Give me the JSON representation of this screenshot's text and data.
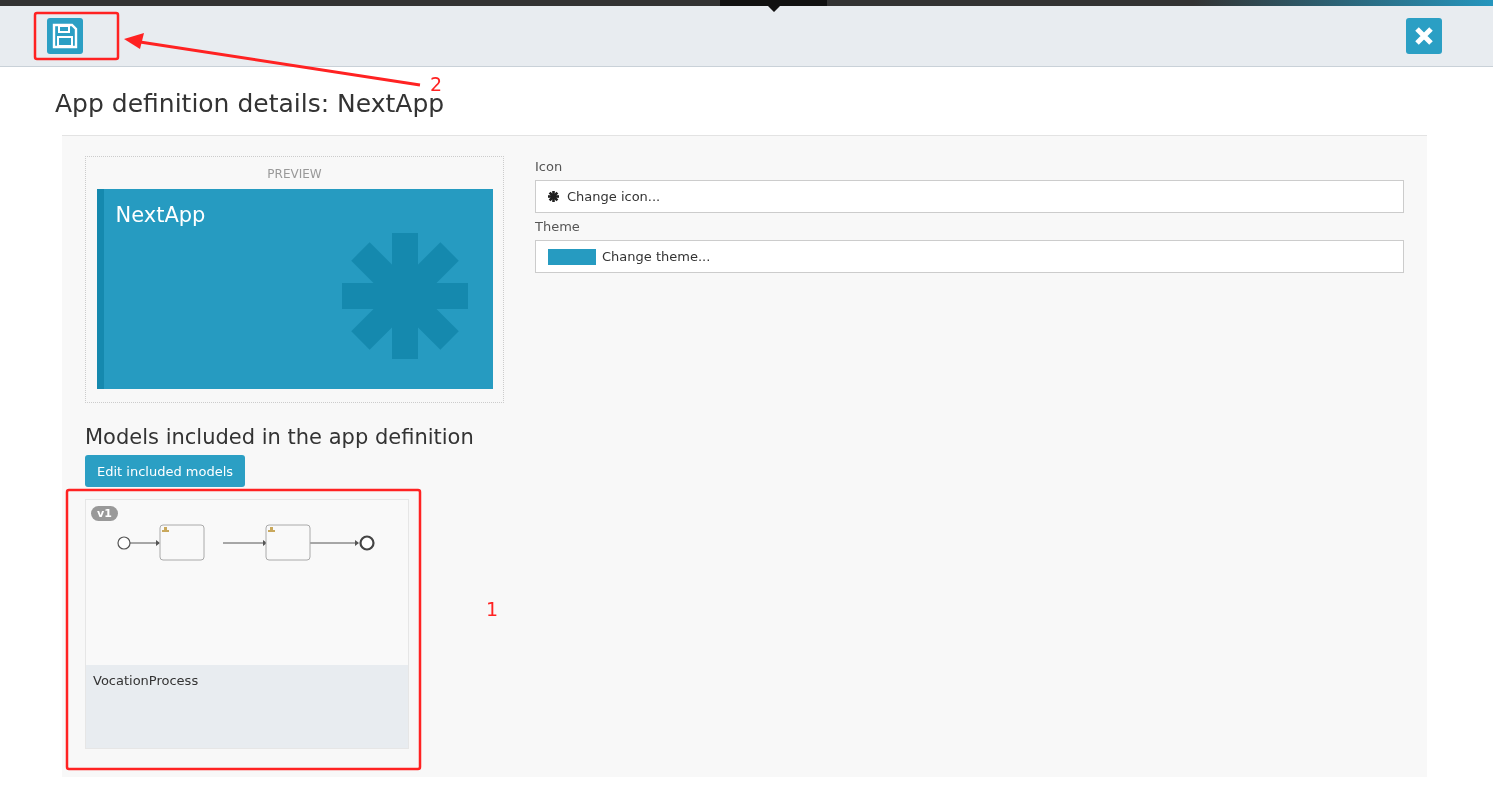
{
  "page_title": "App definition details: NextApp",
  "preview": {
    "label": "PREVIEW",
    "app_name": "NextApp"
  },
  "fields": [
    {
      "kind": "icon",
      "label": "Icon",
      "value": "Change icon..."
    },
    {
      "kind": "theme",
      "label": "Theme",
      "value": "Change theme..."
    }
  ],
  "models_section": {
    "heading": "Models included in the app definition",
    "button": "Edit included models",
    "models": [
      {
        "version": "v1",
        "name": "VocationProcess"
      }
    ]
  },
  "annotations": [
    {
      "label": "2"
    },
    {
      "label": "1"
    }
  ]
}
